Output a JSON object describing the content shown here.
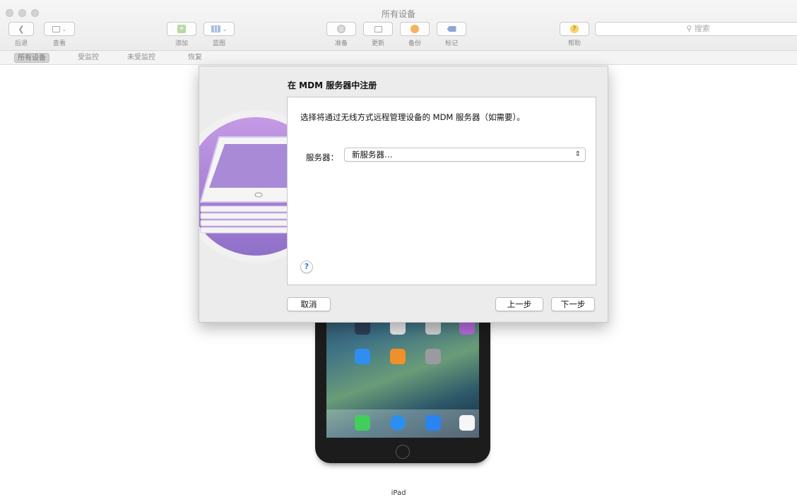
{
  "window": {
    "title": "所有设备"
  },
  "toolbar": {
    "back_label": "后退",
    "view_label": "查看",
    "add_label": "添加",
    "blueprint_label": "蓝图",
    "prepare_label": "准备",
    "update_label": "更新",
    "backup_label": "备份",
    "tag_label": "标记",
    "help_label": "帮助",
    "search_placeholder": "搜索"
  },
  "segments": {
    "all": "所有设备",
    "supervised": "受监控",
    "unsupervised": "未受监控",
    "recovery": "恢复"
  },
  "device": {
    "name": "iPad"
  },
  "sheet": {
    "title": "在 MDM 服务器中注册",
    "description": "选择将通过无线方式远程管理设备的 MDM 服务器（如需要）。",
    "server_label": "服务器：",
    "server_value": "新服务器…",
    "help_glyph": "?",
    "cancel": "取消",
    "previous": "上一步",
    "next": "下一步"
  },
  "colors": {
    "accent": "#2f7be5",
    "logo_purple": "#a884d8"
  }
}
